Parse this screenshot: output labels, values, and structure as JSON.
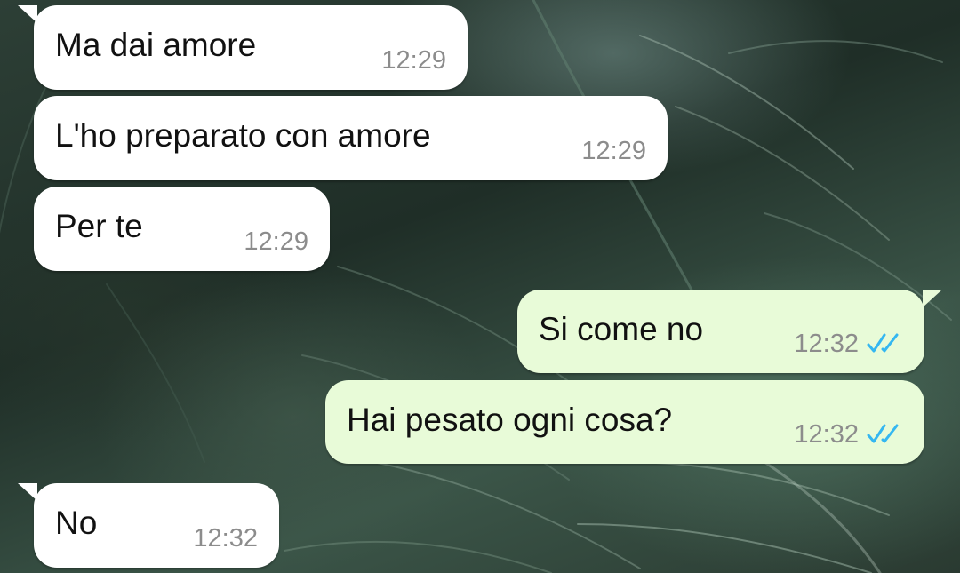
{
  "messages": [
    {
      "direction": "incoming",
      "text": "Ma dai amore",
      "time": "12:29",
      "tail": true
    },
    {
      "direction": "incoming",
      "text": "L'ho preparato con amore",
      "time": "12:29",
      "tail": false
    },
    {
      "direction": "incoming",
      "text": "Per te",
      "time": "12:29",
      "tail": false
    },
    {
      "direction": "outgoing",
      "text": "Si come no",
      "time": "12:32",
      "tail": true,
      "status": "read-double-check"
    },
    {
      "direction": "outgoing",
      "text": "Hai pesato ogni cosa?",
      "time": "12:32",
      "tail": false,
      "status": "read-double-check"
    },
    {
      "direction": "incoming",
      "text": "No",
      "time": "12:32",
      "tail": true
    }
  ],
  "colors": {
    "incoming_bubble": "#ffffff",
    "outgoing_bubble": "#e8fbd8",
    "timestamp": "#8c8c8c",
    "read_ticks": "#34b7f1",
    "wallpaper": "#2d3f36"
  }
}
